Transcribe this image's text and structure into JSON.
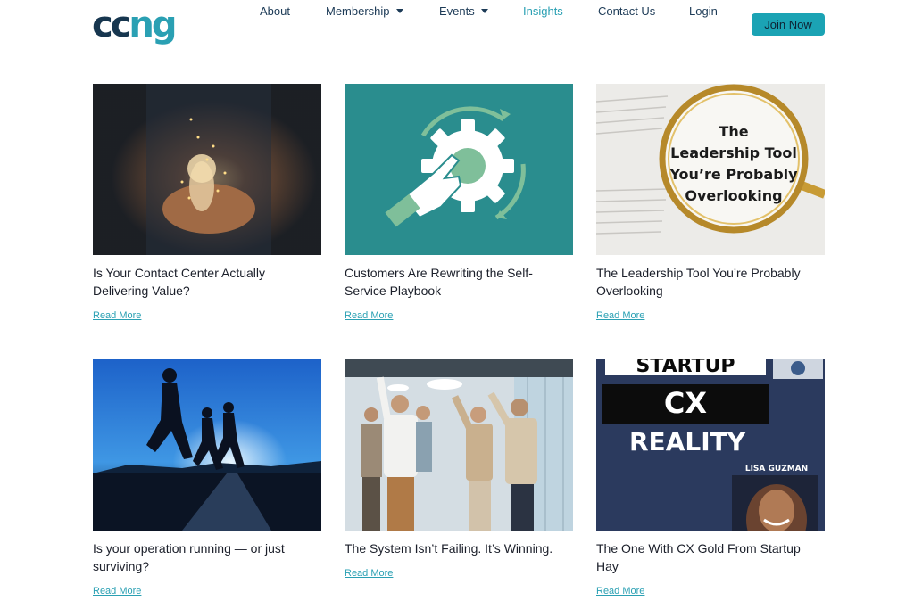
{
  "brand": {
    "logo_text_1": "cc",
    "logo_text_2": "ng",
    "accent": "#2aa0b3",
    "dark": "#17364f"
  },
  "nav": {
    "items": [
      {
        "label": "About",
        "has_dropdown": false,
        "active": false
      },
      {
        "label": "Membership",
        "has_dropdown": true,
        "active": false
      },
      {
        "label": "Events",
        "has_dropdown": true,
        "active": false
      },
      {
        "label": "Insights",
        "has_dropdown": false,
        "active": true
      },
      {
        "label": "Contact Us",
        "has_dropdown": false,
        "active": false
      },
      {
        "label": "Login",
        "has_dropdown": false,
        "active": false
      }
    ],
    "cta": "Join Now"
  },
  "articles": [
    {
      "title": "Is Your Contact Center Actually Delivering Value?",
      "link": "Read More",
      "image": "hands-holding-lightbulb"
    },
    {
      "title": "Customers Are Rewriting the Self-Service Playbook",
      "link": "Read More",
      "image": "hand-gear-refresh-icon"
    },
    {
      "title": "The Leadership Tool You’re Probably Overlooking",
      "link": "Read More",
      "image": "magnifying-glass-book",
      "image_text": [
        "The",
        "Leadership Tool",
        "You’re Probably",
        "Overlooking"
      ]
    },
    {
      "title": "Is your operation running — or just surviving?",
      "link": "Read More",
      "image": "runners-silhouette"
    },
    {
      "title": "The System Isn’t Failing. It’s Winning.",
      "link": "Read More",
      "image": "office-celebration"
    },
    {
      "title": "The One With CX Gold From Startup Hay",
      "link": "Read More",
      "image": "podcast-cover",
      "image_text": [
        "STARTUP",
        "CX",
        "REALITY",
        "LISA GUZMAN"
      ]
    }
  ]
}
